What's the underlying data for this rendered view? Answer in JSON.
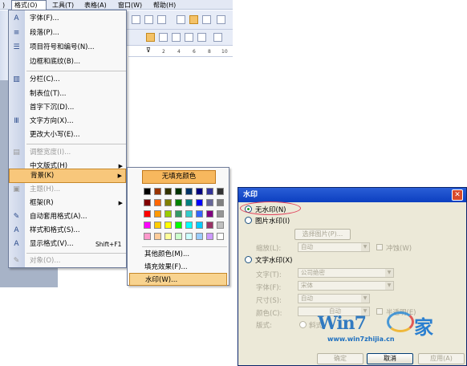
{
  "menubar": {
    "format_label": "格式(O)",
    "tools_label": "工具(T)",
    "table_label": "表格(A)",
    "window_label": "窗口(W)",
    "help_label": "帮助(H)"
  },
  "ruler": [
    "2",
    "4",
    "6",
    "8",
    "10"
  ],
  "format_menu": {
    "items": [
      {
        "label": "字体(F)...",
        "icon": "A"
      },
      {
        "label": "段落(P)...",
        "icon": "≡"
      },
      {
        "label": "项目符号和编号(N)...",
        "icon": "☰"
      },
      {
        "label": "边框和底纹(B)...",
        "icon": ""
      },
      {
        "label": "分栏(C)...",
        "icon": "▥"
      },
      {
        "label": "制表位(T)...",
        "icon": ""
      },
      {
        "label": "首字下沉(D)...",
        "icon": ""
      },
      {
        "label": "文字方向(X)...",
        "icon": "Ⅲ"
      },
      {
        "label": "更改大小写(E)...",
        "icon": ""
      },
      {
        "label": "调整宽度(I)...",
        "icon": "▤"
      },
      {
        "label": "中文版式(H)",
        "icon": ""
      },
      {
        "label": "背景(K)",
        "icon": ""
      },
      {
        "label": "主题(H)...",
        "icon": "▣"
      },
      {
        "label": "框架(R)",
        "icon": ""
      },
      {
        "label": "自动套用格式(A)...",
        "icon": "✎"
      },
      {
        "label": "样式和格式(S)...",
        "icon": "A"
      },
      {
        "label": "显示格式(V)...",
        "icon": "A"
      },
      {
        "label": "对象(O)...",
        "icon": "✎"
      }
    ],
    "shortcut": "Shift+F1"
  },
  "background_submenu": {
    "no_fill": "无填充颜色",
    "more_colors": "其他颜色(M)...",
    "fill_effects": "填充效果(F)...",
    "watermark": "水印(W)..."
  },
  "swatch_colors": [
    [
      "#000000",
      "#993300",
      "#333300",
      "#003300",
      "#003366",
      "#000080",
      "#333399",
      "#333333"
    ],
    [
      "#800000",
      "#ff6600",
      "#808000",
      "#008000",
      "#008080",
      "#0000ff",
      "#666699",
      "#808080"
    ],
    [
      "#ff0000",
      "#ff9900",
      "#99cc00",
      "#339966",
      "#33cccc",
      "#3366ff",
      "#800080",
      "#969696"
    ],
    [
      "#ff00ff",
      "#ffcc00",
      "#ffff00",
      "#00ff00",
      "#00ffff",
      "#00ccff",
      "#993366",
      "#c0c0c0"
    ],
    [
      "#ff99cc",
      "#ffcc99",
      "#ffff99",
      "#ccffcc",
      "#ccffff",
      "#99ccff",
      "#cc99ff",
      "#ffffff"
    ]
  ],
  "dialog": {
    "title": "水印",
    "no_watermark": "无水印(N)",
    "picture_watermark": "图片水印(I)",
    "select_picture": "选择图片(P)...",
    "scale_label": "缩放(L):",
    "scale_value": "自动",
    "washout_label": "冲蚀(W)",
    "text_watermark": "文字水印(X)",
    "language_label": "语言(L):",
    "language_value": "中文(中国)",
    "text_label": "文字(T):",
    "text_value": "公司绝密",
    "font_label": "字体(F):",
    "font_value": "宋体",
    "size_label": "尺寸(S):",
    "size_value": "自动",
    "color_label": "颜色(C):",
    "color_value": "自动",
    "semitransparent_label": "半透明(E)",
    "layout_label": "版式:",
    "diagonal_label": "斜式",
    "ok_label": "确定",
    "cancel_label": "取消",
    "apply_label": "应用(A)"
  },
  "logo": {
    "text": "Win7",
    "char": "家",
    "url": "www.win7zhijia.cn"
  }
}
